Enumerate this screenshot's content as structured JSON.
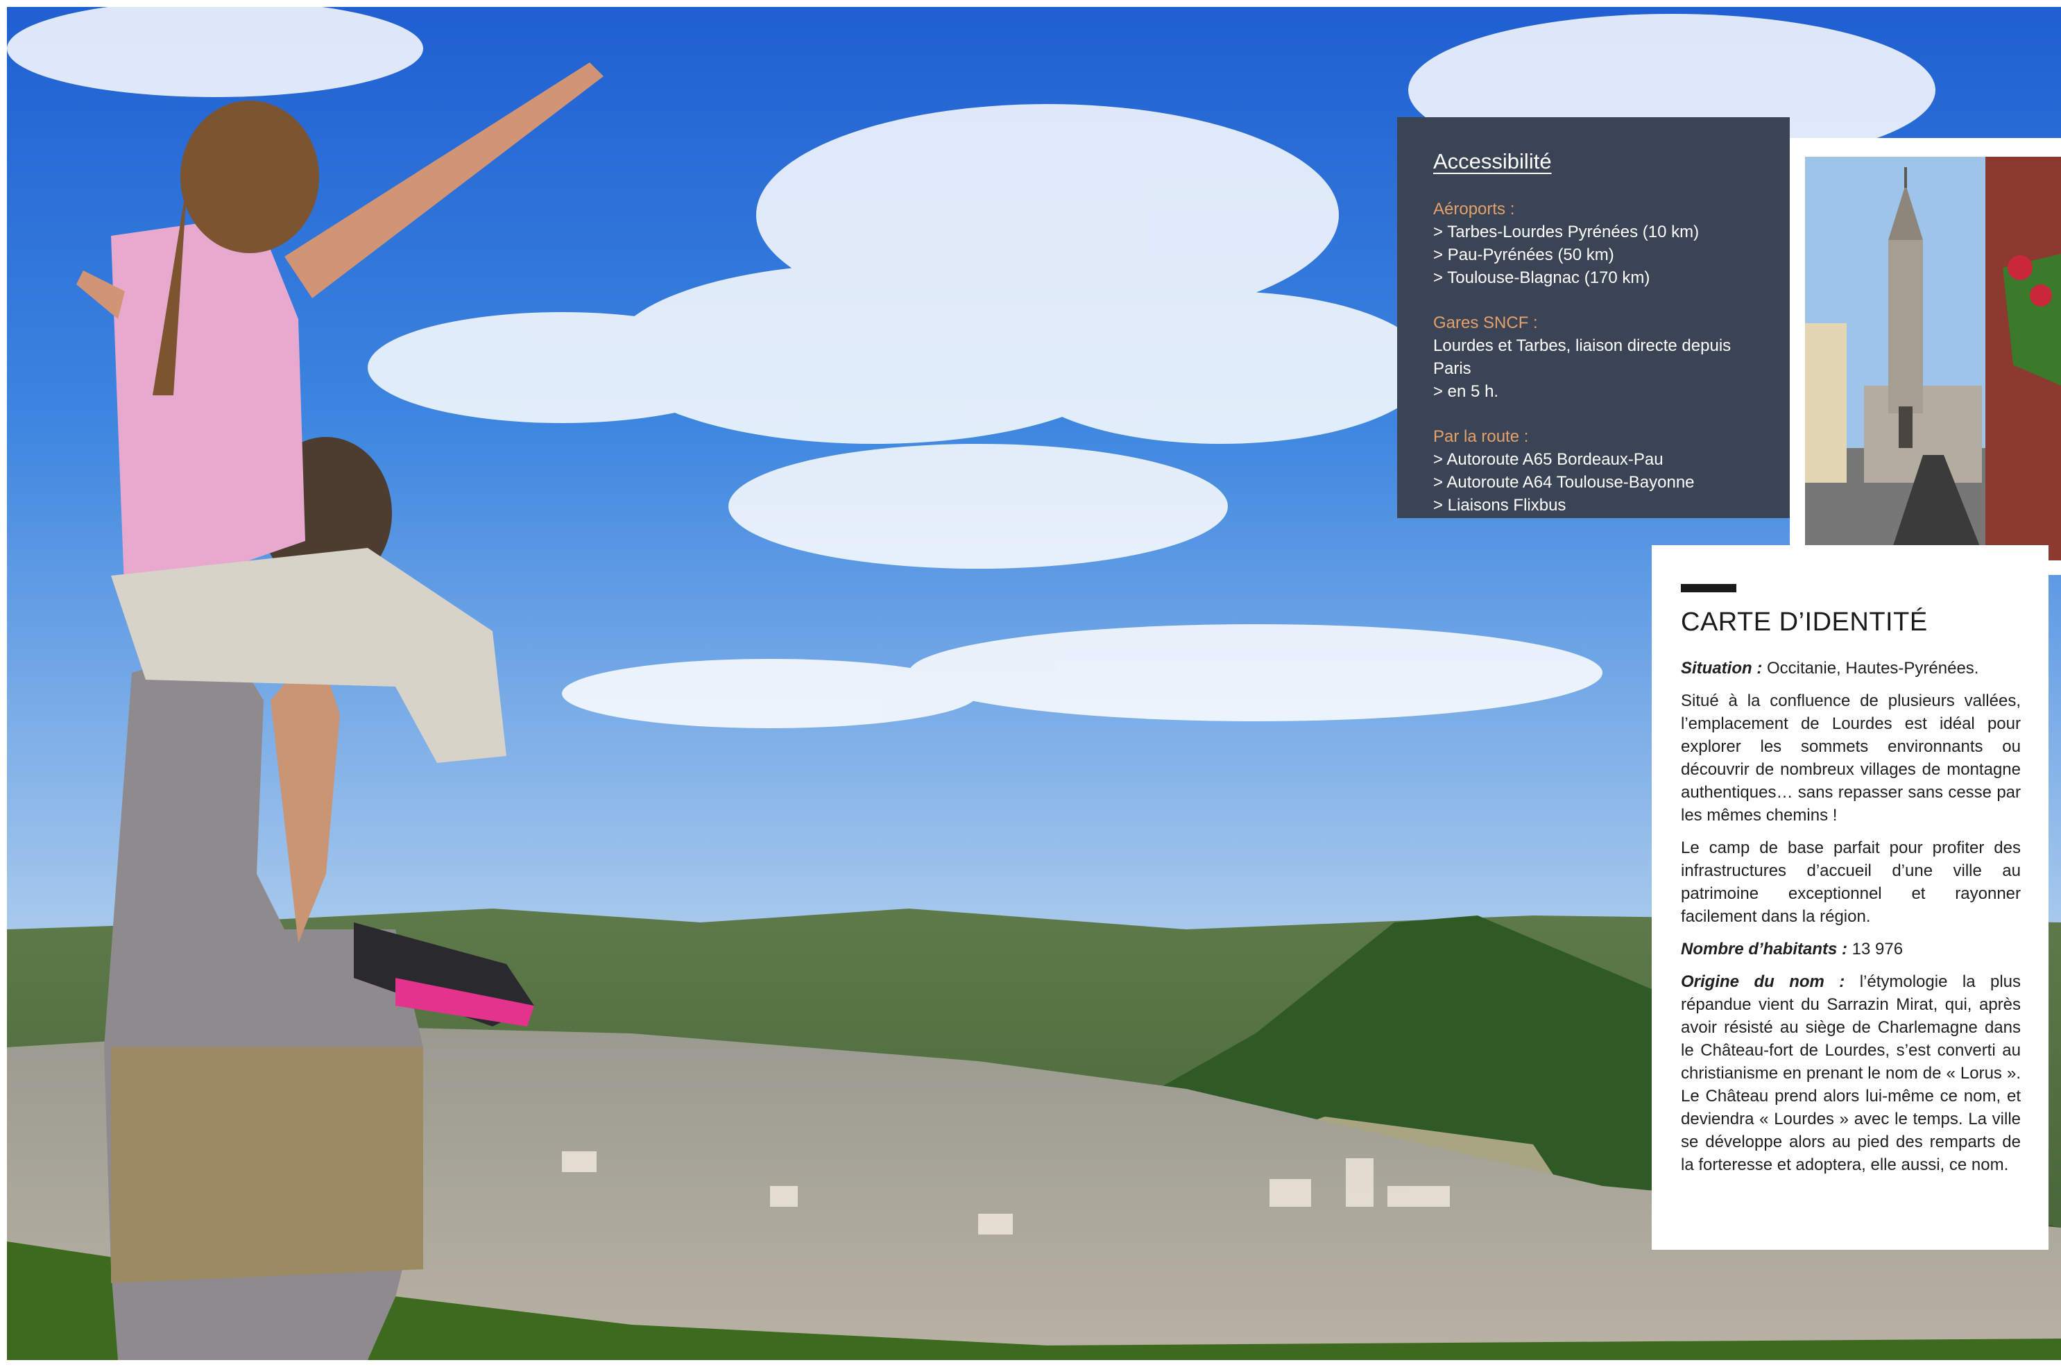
{
  "access": {
    "title": "Accessibilité",
    "groups": [
      {
        "label": "Aéroports :",
        "lines": [
          "> Tarbes-Lourdes Pyrénées (10 km)",
          "> Pau-Pyrénées (50 km)",
          "> Toulouse-Blagnac (170 km)"
        ]
      },
      {
        "label": "Gares SNCF :",
        "lines": [
          "Lourdes et Tarbes, liaison directe depuis Paris",
          "> en 5 h."
        ]
      },
      {
        "label": "Par la route :",
        "lines": [
          "> Autoroute A65 Bordeaux-Pau",
          "> Autoroute A64 Toulouse-Bayonne",
          "> Liaisons Flixbus"
        ]
      }
    ]
  },
  "identity": {
    "title": "CARTE D’IDENTITÉ",
    "situation_label": "Situation :",
    "situation_value": " Occitanie, Hautes-Pyrénées.",
    "para1": "Situé à la confluence de plusieurs vallées, l’emplacement de Lourdes est idéal pour explorer les sommets environnants ou découvrir de nombreux villages de montagne authentiques… sans repasser sans cesse par les mêmes chemins !",
    "para2": "Le camp de base parfait pour profiter des infrastructures d’accueil d’une ville au patrimoine exceptionnel et rayonner facilement dans la région.",
    "inhabitants_label": "Nombre d’habitants :",
    "inhabitants_value": " 13 976",
    "origin_label": "Origine du nom :",
    "origin_value": " l’étymologie la plus répandue vient du Sarrazin Mirat, qui, après avoir résisté au siège de Charlemagne dans le Château-fort de Lourdes, s’est converti au christianisme en prenant le nom de « Lorus ». Le Château prend alors lui-même ce nom, et deviendra « Lourdes » avec le temps. La ville se développe alors au pied des remparts de la forteresse et adoptera, elle aussi, ce nom."
  }
}
